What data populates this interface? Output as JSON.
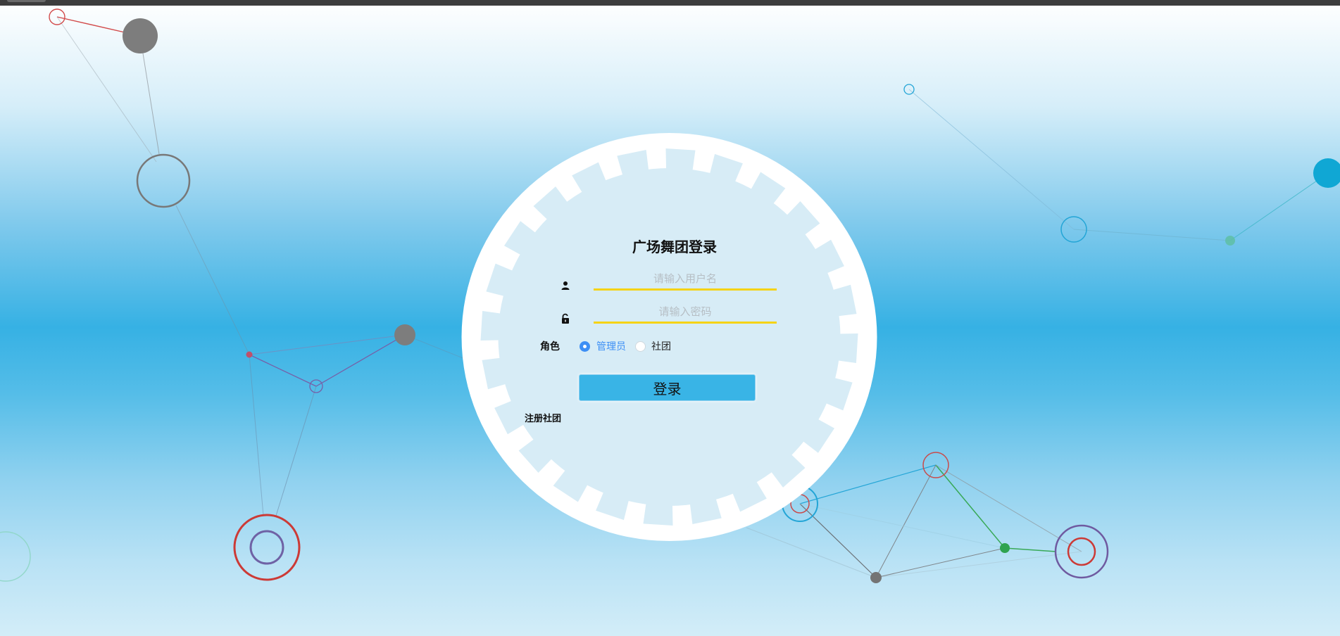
{
  "login": {
    "title": "广场舞团登录",
    "username_placeholder": "请输入用户名",
    "password_placeholder": "请输入密码",
    "role_label": "角色",
    "roles": [
      {
        "label": "管理员",
        "selected": true
      },
      {
        "label": "社团",
        "selected": false
      }
    ],
    "submit_label": "登录",
    "register_label": "注册社团"
  },
  "colors": {
    "accent": "#39b4e6",
    "input_underline": "#f5d315",
    "radio_selected": "#3d8ff5",
    "gear_outer": "#ffffff",
    "gear_inner": "#d7ecf6"
  },
  "icons": {
    "username": "user-icon",
    "password": "unlock-icon"
  }
}
